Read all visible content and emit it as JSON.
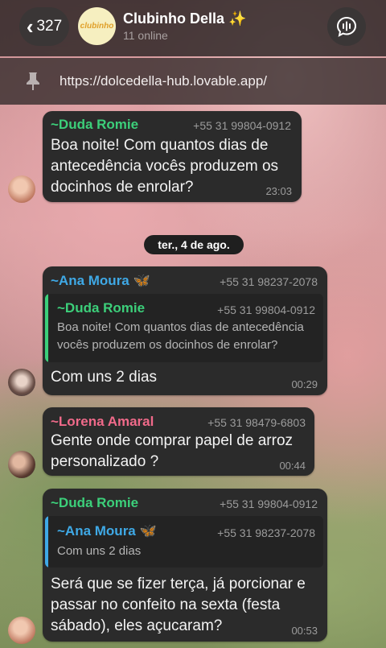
{
  "header": {
    "back_count": "327",
    "group_logo_text": "clubinho",
    "title": "Clubinho Della ✨",
    "subtitle": "11 online"
  },
  "pinned": {
    "url": "https://dolcedella-hub.lovable.app/"
  },
  "date_separator": "ter., 4 de ago.",
  "messages": [
    {
      "sender": "~Duda Romie",
      "sender_color": "#3ccf7a",
      "phone": "+55 31 99804-0912",
      "lines": [
        "Boa noite! Com quantos dias de",
        "antecedência vocês produzem os",
        "docinhos de enrolar?"
      ],
      "time": "23:03"
    },
    {
      "sender": "~Ana Moura 🦋",
      "sender_color": "#3fa9e6",
      "phone": "+55 31 98237-2078",
      "quote": {
        "sender": "~Duda Romie",
        "sender_color": "#3ccf7a",
        "phone": "+55 31 99804-0912",
        "lines": [
          "Boa noite! Com quantos dias de antecedência",
          "vocês produzem os docinhos de enrolar?"
        ]
      },
      "lines": [
        "Com uns 2 dias"
      ],
      "time": "00:29"
    },
    {
      "sender": "~Lorena Amaral",
      "sender_color": "#f06a8a",
      "phone": "+55 31 98479-6803",
      "lines": [
        "Gente onde comprar papel de arroz",
        "personalizado ?"
      ],
      "time": "00:44"
    },
    {
      "sender": "~Duda Romie",
      "sender_color": "#3ccf7a",
      "phone": "+55 31 99804-0912",
      "quote": {
        "sender": "~Ana Moura 🦋",
        "sender_color": "#3fa9e6",
        "phone": "+55 31 98237-2078",
        "lines": [
          "Com uns 2 dias"
        ]
      },
      "lines": [
        "Será que se fizer terça, já porcionar e",
        "passar no confeito na sexta (festa",
        "sábado), eles açucaram?"
      ],
      "time": "00:53"
    }
  ]
}
